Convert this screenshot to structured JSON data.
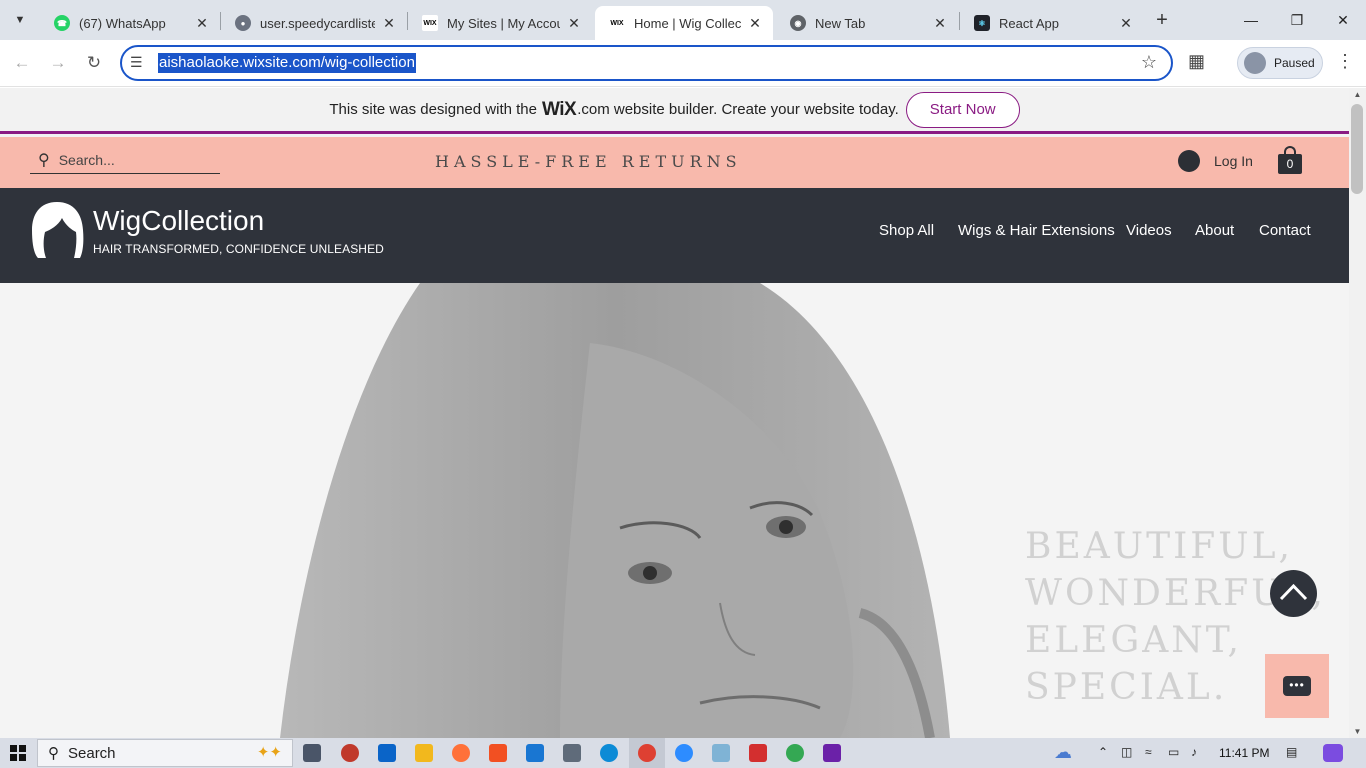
{
  "browser": {
    "tabs": [
      {
        "title": "(67) WhatsApp",
        "icon": "whatsapp-icon",
        "active": false
      },
      {
        "title": "user.speedycardlister",
        "icon": "globe-icon",
        "active": false
      },
      {
        "title": "My Sites | My Accoun",
        "icon": "wix-icon",
        "active": false
      },
      {
        "title": "Home | Wig Collectio",
        "icon": "wix-icon",
        "active": true
      },
      {
        "title": "New Tab",
        "icon": "chrome-icon",
        "active": false
      },
      {
        "title": "React App",
        "icon": "react-icon",
        "active": false
      }
    ],
    "favicon_wix_text": "WIX",
    "url": "aishaolaoke.wixsite.com/wig-collection",
    "profile_label": "Paused",
    "accent": "#1a55c9"
  },
  "wix_banner": {
    "text_before": "This site was designed with the",
    "logo": "WiX",
    "text_after": ".com website builder. Create your website today.",
    "button": "Start Now",
    "accent": "#8a1b83"
  },
  "site": {
    "search_placeholder": "Search...",
    "slogan": "HASSLE-FREE RETURNS",
    "login": "Log In",
    "cart_count": "0",
    "brand": "WigCollection",
    "tagline": "HAIR TRANSFORMED, CONFIDENCE UNLEASHED",
    "nav": [
      "Shop All",
      "Wigs & Hair Extensions",
      "Videos",
      "About",
      "Contact"
    ],
    "hero_lines": [
      "BEAUTIFUL,",
      "WONDERFUL,",
      "ELEGANT,",
      "SPECIAL."
    ],
    "colors": {
      "promo_bar": "#f8b9ac",
      "header": "#2f333b"
    }
  },
  "taskbar": {
    "search": "Search",
    "time": "11:41 PM"
  }
}
